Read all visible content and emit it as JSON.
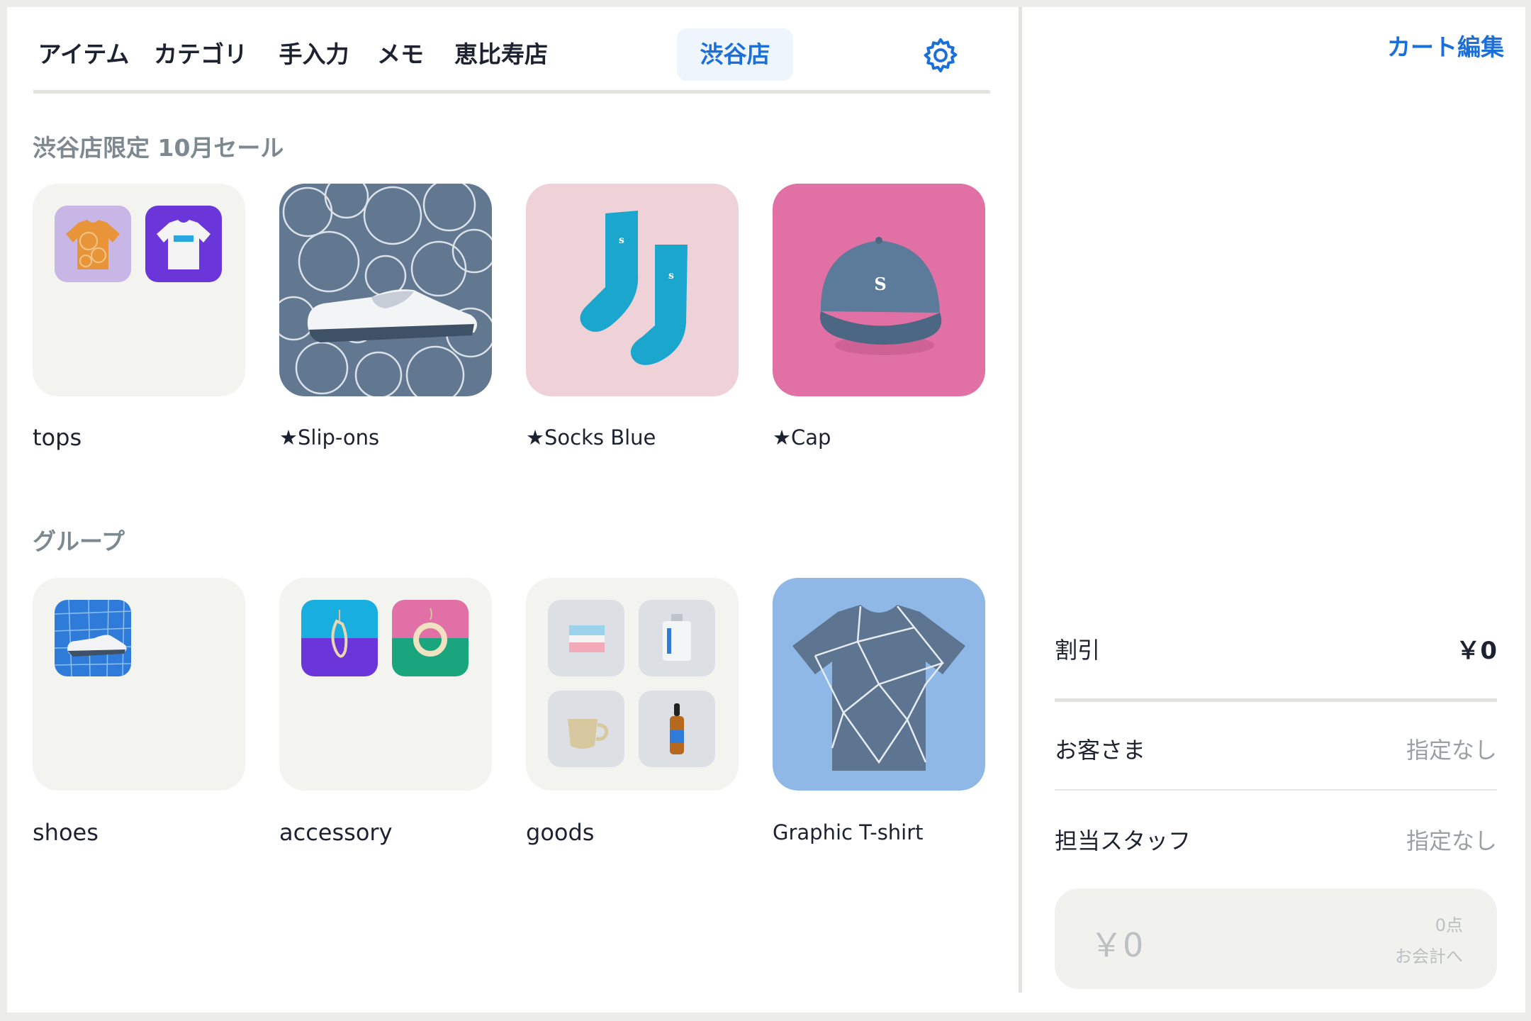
{
  "tabs": [
    {
      "label": "アイテム"
    },
    {
      "label": "カテゴリ"
    },
    {
      "label": "手入力"
    },
    {
      "label": "メモ"
    },
    {
      "label": "恵比寿店"
    },
    {
      "label": "渋谷店",
      "active": true
    }
  ],
  "settings_icon": "gear-icon",
  "sections": {
    "sale": {
      "title": "渋谷店限定 10月セール",
      "tiles": [
        {
          "label": "tops"
        },
        {
          "label": "★Slip-ons"
        },
        {
          "label": "★Socks Blue"
        },
        {
          "label": "★Cap"
        }
      ]
    },
    "groups": {
      "title": "グループ",
      "tiles": [
        {
          "label": "shoes"
        },
        {
          "label": "accessory"
        },
        {
          "label": "goods"
        },
        {
          "label": "Graphic T-shirt"
        }
      ]
    }
  },
  "cart": {
    "edit_label": "カート編集",
    "discount_label": "割引",
    "discount_value": "￥0",
    "customer_label": "お客さま",
    "customer_value": "指定なし",
    "staff_label": "担当スタッフ",
    "staff_value": "指定なし",
    "checkout_amount": "￥0",
    "checkout_count": "0点",
    "checkout_label": "お会計へ"
  },
  "colors": {
    "accent": "#1b6fd8",
    "tile_background": "#f3f3f0",
    "slipons_background": "#627891",
    "socks_background": "#efd2d7",
    "cap_background": "#e170a5",
    "tshirt_background": "#8fb8e6"
  }
}
